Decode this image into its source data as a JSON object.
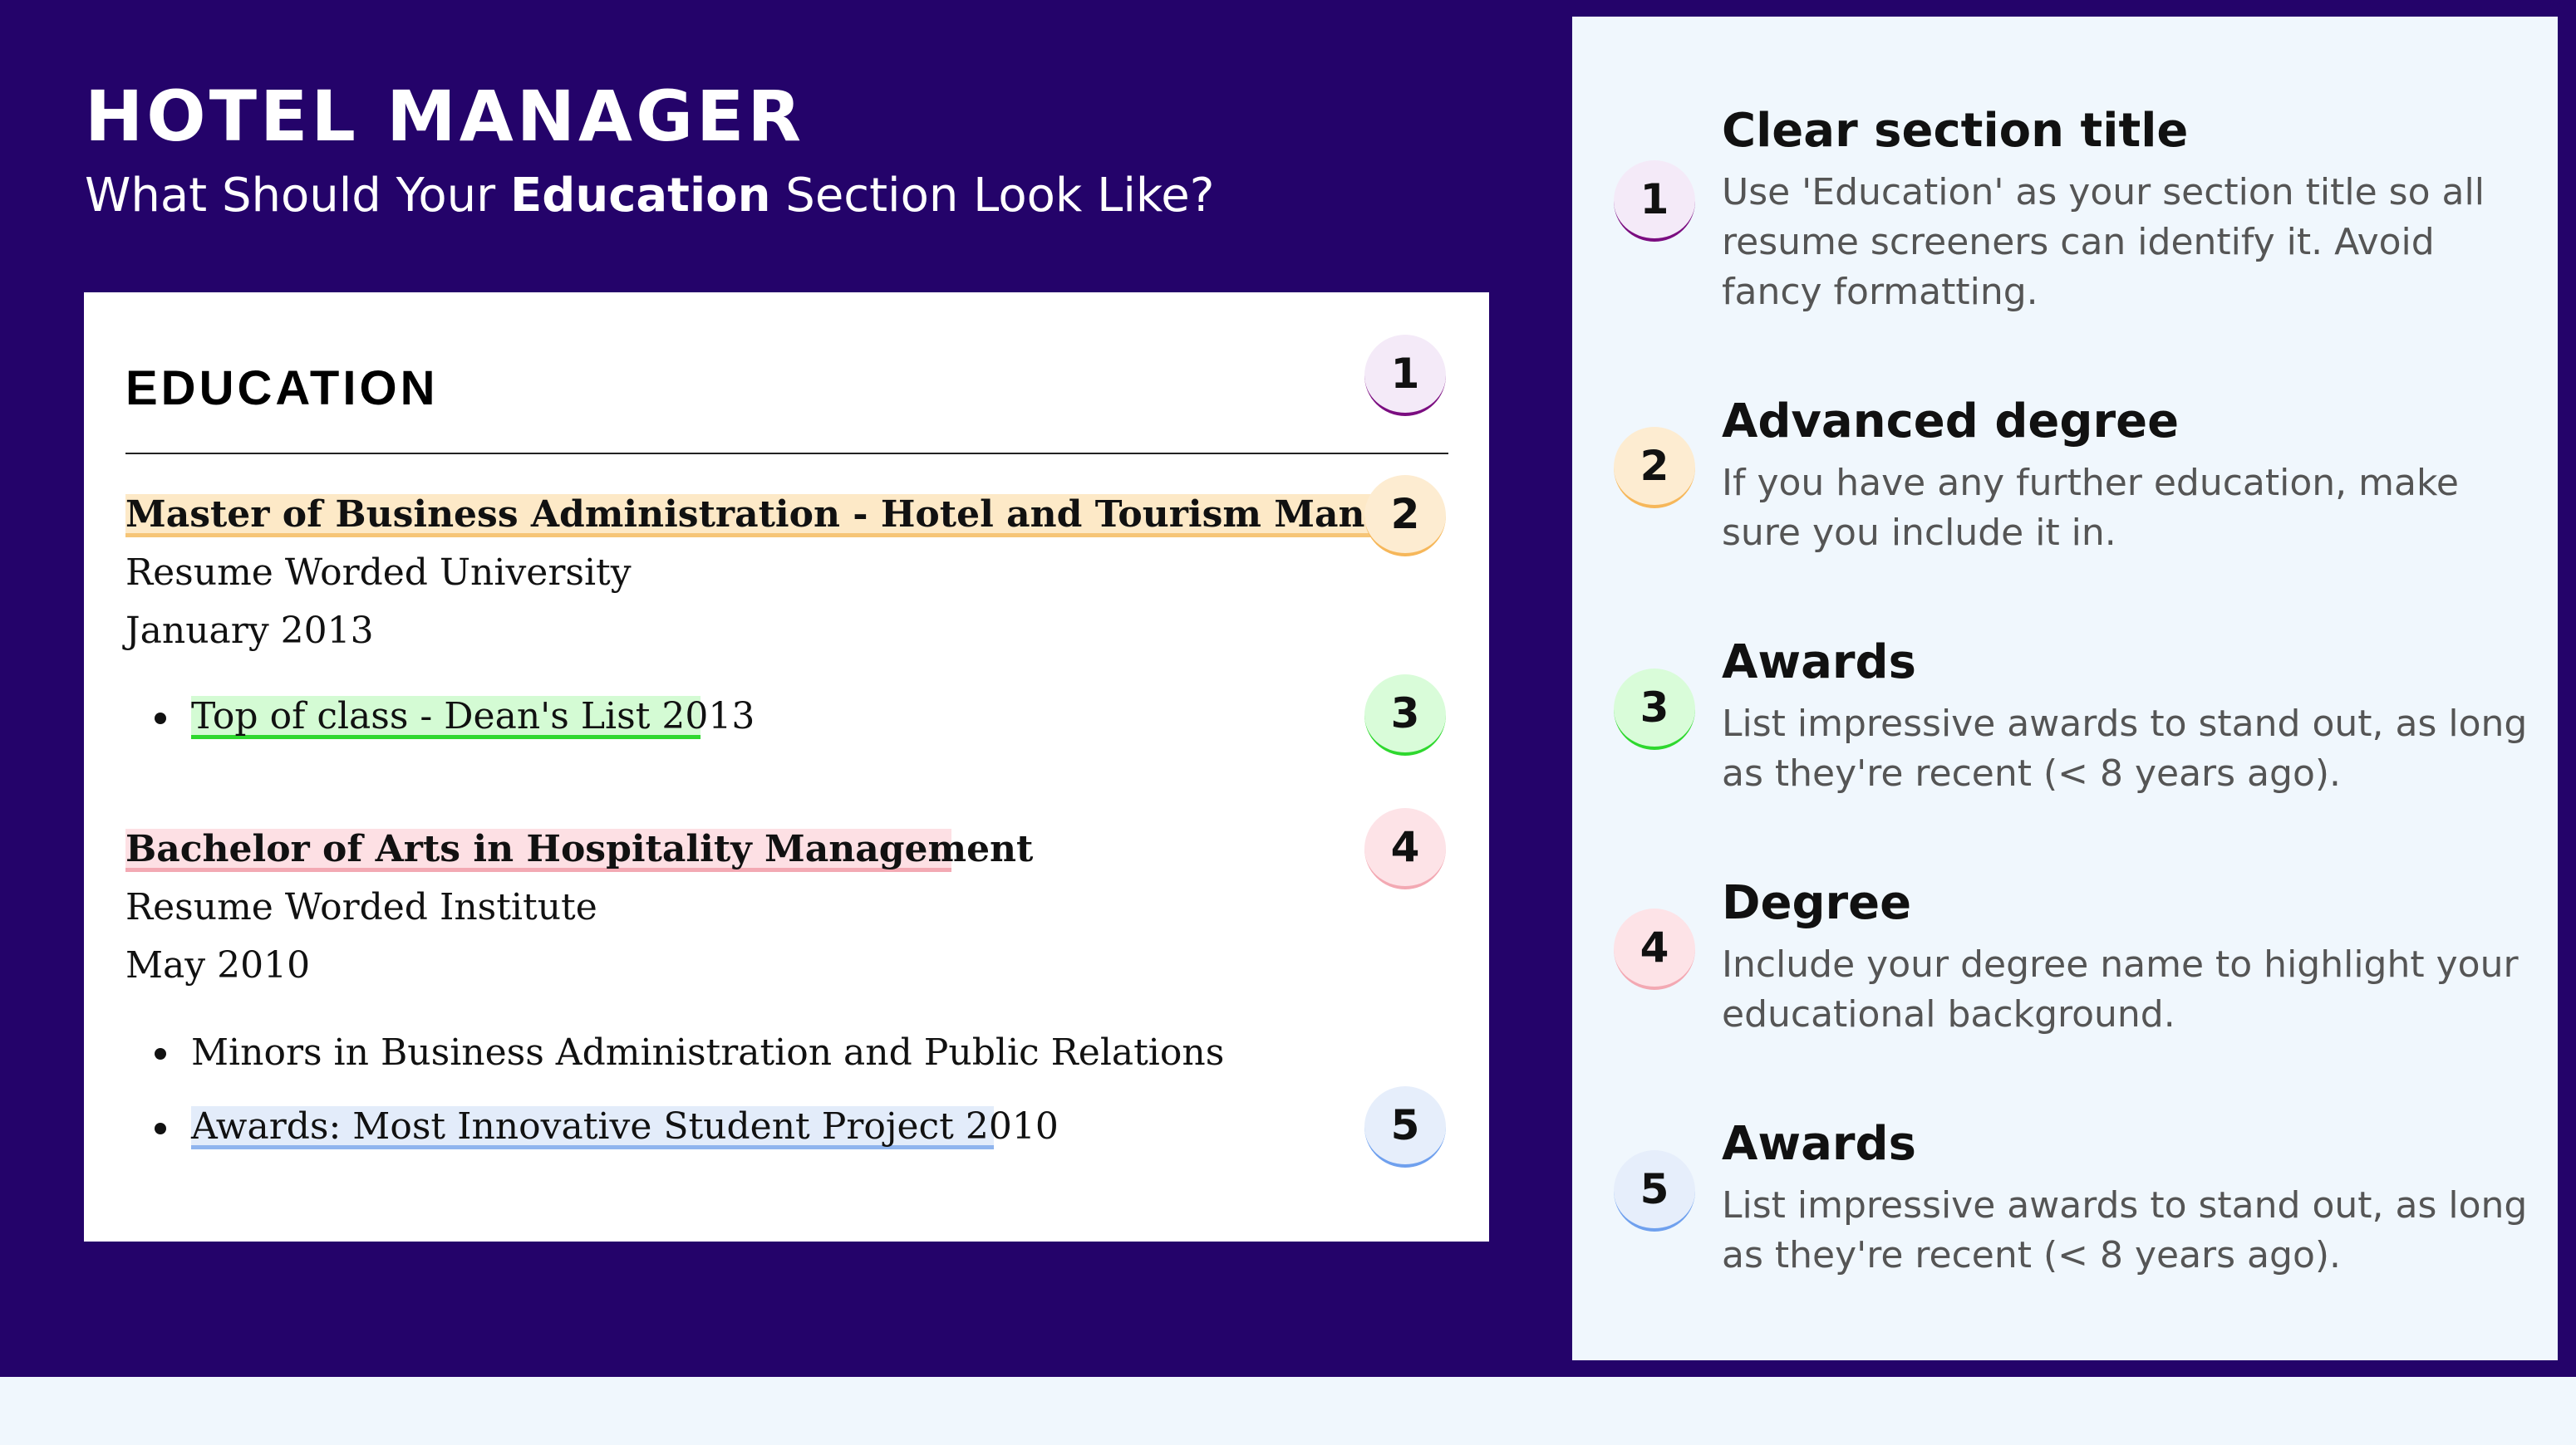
{
  "header": {
    "title": "HOTEL MANAGER",
    "subtitle_prefix": "What Should Your ",
    "subtitle_emphasis": "Education",
    "subtitle_suffix": " Section Look Like?"
  },
  "resume": {
    "section_title": "EDUCATION",
    "entries": [
      {
        "degree": "Master of Business Administration - Hotel and Tourism Management",
        "school": "Resume Worded University",
        "date": "January 2013",
        "bullets": [
          "Top of class - Dean's List 2013"
        ]
      },
      {
        "degree": "Bachelor of Arts in Hospitality Management",
        "school": "Resume Worded Institute",
        "date": "May 2010",
        "bullets": [
          "Minors in Business Administration and Public Relations",
          "Awards: Most Innovative Student Project 2010"
        ]
      }
    ]
  },
  "markers": [
    "1",
    "2",
    "3",
    "4",
    "5"
  ],
  "tips": [
    {
      "number": "1",
      "title": "Clear section title",
      "body": "Use 'Education' as your section title so all resume screeners can identify it. Avoid fancy formatting."
    },
    {
      "number": "2",
      "title": "Advanced degree",
      "body": "If you have any further education, make sure you include it in."
    },
    {
      "number": "3",
      "title": "Awards",
      "body": "List impressive awards to stand out, as long as they're recent (< 8 years ago)."
    },
    {
      "number": "4",
      "title": "Degree",
      "body": "Include your degree name to highlight your educational background."
    },
    {
      "number": "5",
      "title": "Awards",
      "body": "List impressive awards to stand out, as long as they're recent (< 8 years ago)."
    }
  ],
  "colors": {
    "background": "#24036a",
    "panel": "#f0f7fd",
    "marker_1": "#7b0d80",
    "marker_2": "#f6b75a",
    "marker_3": "#2ed82e",
    "marker_4": "#f3a9b3",
    "marker_5": "#6fa0ee"
  }
}
